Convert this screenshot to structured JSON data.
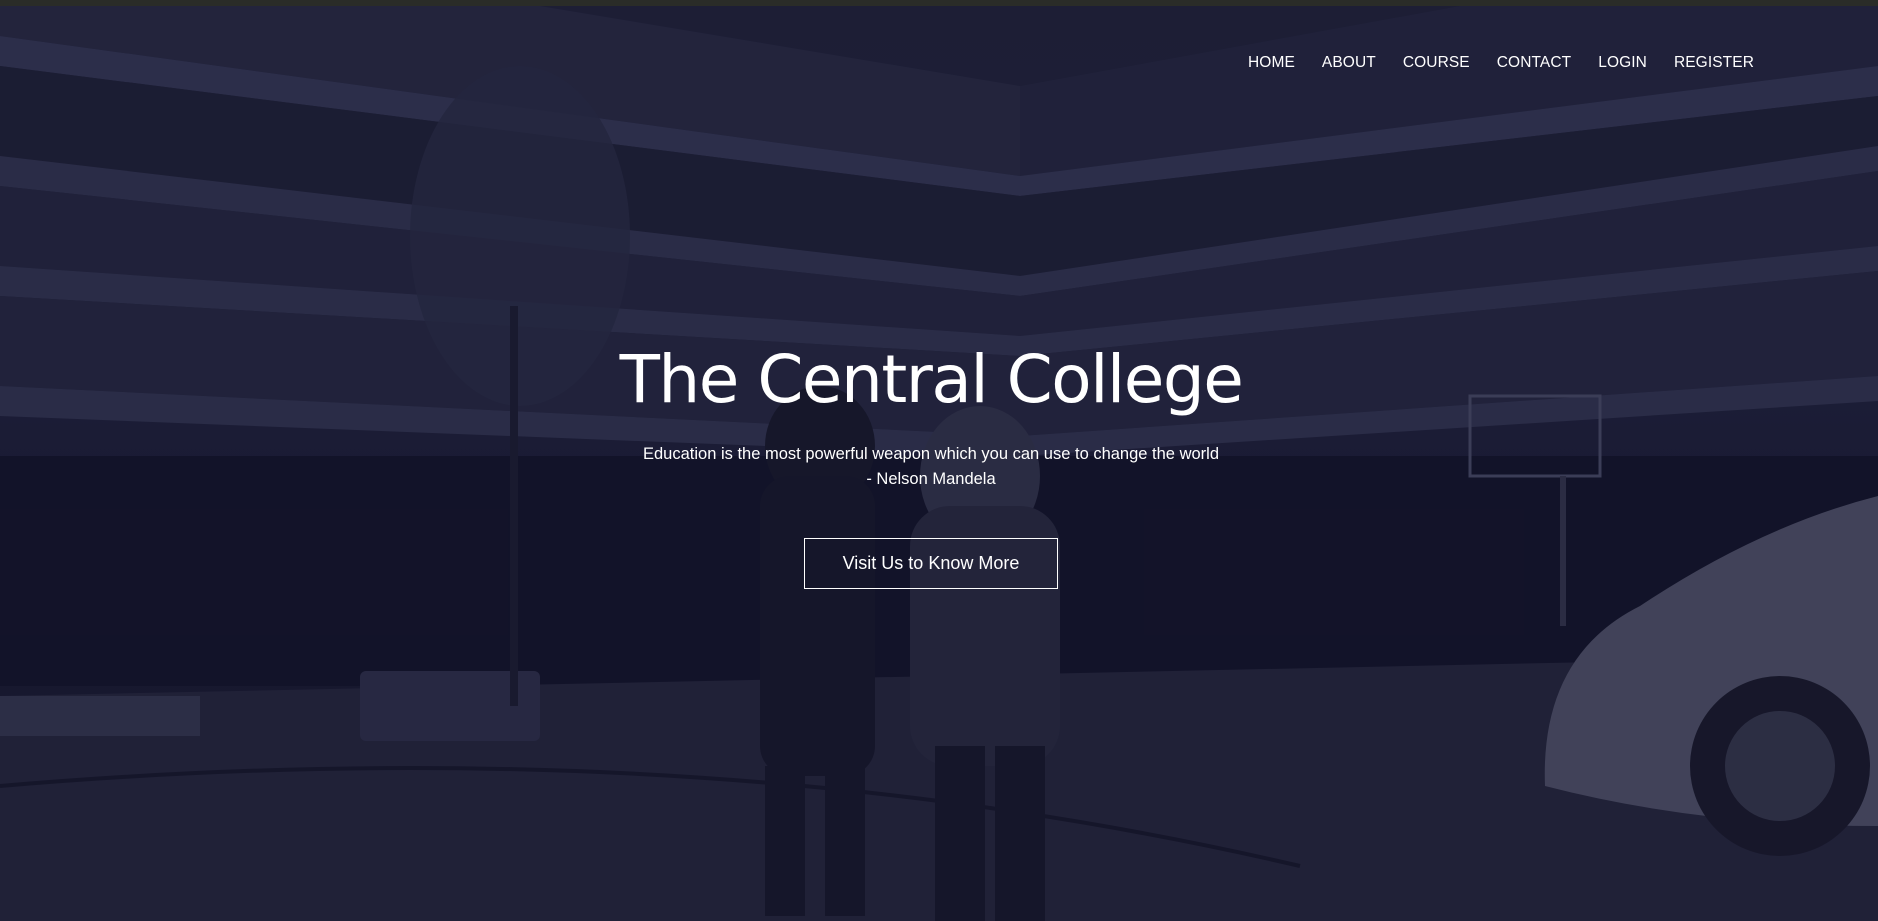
{
  "nav": {
    "items": [
      {
        "label": "HOME"
      },
      {
        "label": "ABOUT"
      },
      {
        "label": "COURSE"
      },
      {
        "label": "CONTACT"
      },
      {
        "label": "LOGIN"
      },
      {
        "label": "REGISTER"
      }
    ]
  },
  "hero": {
    "title": "The Central College",
    "quote_line1": "Education is the most powerful weapon which you can use to change the world",
    "quote_line2": "- Nelson Mandela",
    "cta_label": "Visit Us to Know More"
  },
  "colors": {
    "overlay": "#1d1e30",
    "text": "#ffffff"
  }
}
